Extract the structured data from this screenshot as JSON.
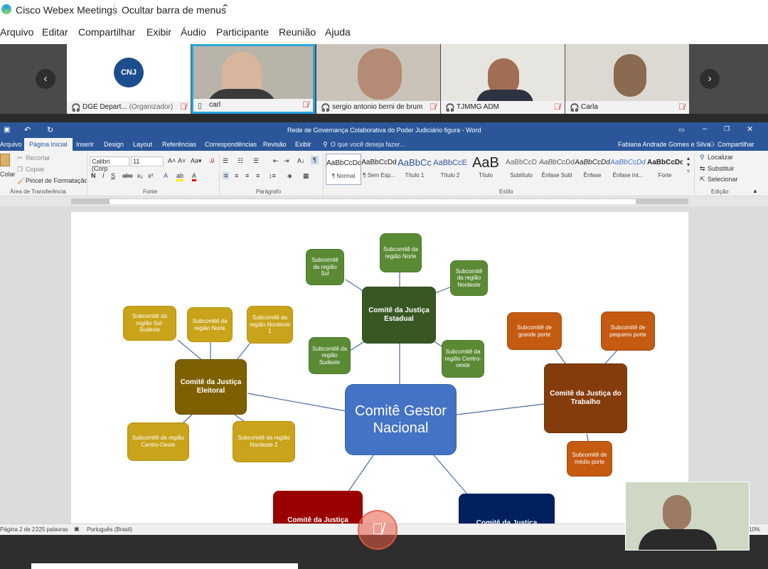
{
  "webex": {
    "app_title": "Cisco Webex Meetings",
    "hide_menu_label": "Ocultar barra de menus",
    "menu": [
      "Arquivo",
      "Editar",
      "Compartilhar",
      "Exibir",
      "Áudio",
      "Participante",
      "Reunião",
      "Ajuda"
    ],
    "participants": [
      {
        "name": "DGE Depart...",
        "role": "(Organizador)",
        "muted": true,
        "logo": "CNJ"
      },
      {
        "name": "carl",
        "role": "",
        "muted": true,
        "active": true
      },
      {
        "name": "sergio antonio berni de brum",
        "role": "",
        "muted": true
      },
      {
        "name": "TJMMG ADM",
        "role": "",
        "muted": true
      },
      {
        "name": "Carla",
        "role": "",
        "muted": true
      }
    ]
  },
  "word": {
    "doc_title": "Rede de Governança Colaborativa do Poder Judiciário figura - Word",
    "tabs": [
      "Arquivo",
      "Página Inicial",
      "Inserir",
      "Design",
      "Layout",
      "Referências",
      "Correspondências",
      "Revisão",
      "Exibir"
    ],
    "active_tab": "Página Inicial",
    "tell_me": "O que você deseja fazer...",
    "user": "Fabiana Andrade Gomes e Silva",
    "share": "Compartilhar",
    "clipboard": {
      "paste": "Colar",
      "cut": "Recortar",
      "copy": "Copiar",
      "format_painter": "Pincel de Formatação",
      "label": "Área de Transferência"
    },
    "font": {
      "name": "Calibri (Corp",
      "size": "11",
      "label": "Fonte"
    },
    "paragraph_label": "Parágrafo",
    "styles": [
      {
        "preview": "AaBbCcDd",
        "name": "¶ Normal"
      },
      {
        "preview": "AaBbCcDd",
        "name": "¶ Sem Esp..."
      },
      {
        "preview": "AaBbCc",
        "name": "Título 1"
      },
      {
        "preview": "AaBbCcE",
        "name": "Título 2"
      },
      {
        "preview": "AaB",
        "name": "Título"
      },
      {
        "preview": "AaBbCcD",
        "name": "Subtítulo"
      },
      {
        "preview": "AaBbCcDd",
        "name": "Ênfase Sutil"
      },
      {
        "preview": "AaBbCcDd",
        "name": "Ênfase"
      },
      {
        "preview": "AaBbCcDd",
        "name": "Ênfase Int..."
      },
      {
        "preview": "AaBbCcDc",
        "name": "Forte"
      }
    ],
    "styles_label": "Estilo",
    "editing": {
      "find": "Localizar",
      "replace": "Substituir",
      "select": "Selecionar",
      "label": "Edição"
    },
    "status": {
      "page": "Página 2 de 2",
      "words": "225 palavras",
      "lang": "Português (Brasil)",
      "zoom": "10%"
    }
  },
  "diagram": {
    "center": "Comitê Gestor Nacional",
    "estadual": {
      "title": "Comitê da Justiça Estadual",
      "subs": [
        "Subcomitê da região Sul",
        "Subcomitê da região Norte",
        "Subcomitê da região Nordeste",
        "Subcomitê da região Sudeste",
        "Subcomitê da região Centro-oeste"
      ]
    },
    "eleitoral": {
      "title": "Comitê da Justiça Eleitoral",
      "subs": [
        "Subcomitê da região Sul-Sudeste",
        "Subcomitê da região Norte",
        "Subcomitê da região Nordeste 1",
        "Subcomitê da região Centro-Oeste",
        "Subcomitê da região Nordeste 2"
      ]
    },
    "trabalho": {
      "title": "Comitê da Justiça do Trabalho",
      "subs": [
        "Subcomitê de grande porte",
        "Subcomitê de pequeno porte",
        "Subcomitê de médio porte"
      ]
    },
    "cut_left": "Comitê da Justiça",
    "cut_right": "Comitê da Justiça"
  }
}
